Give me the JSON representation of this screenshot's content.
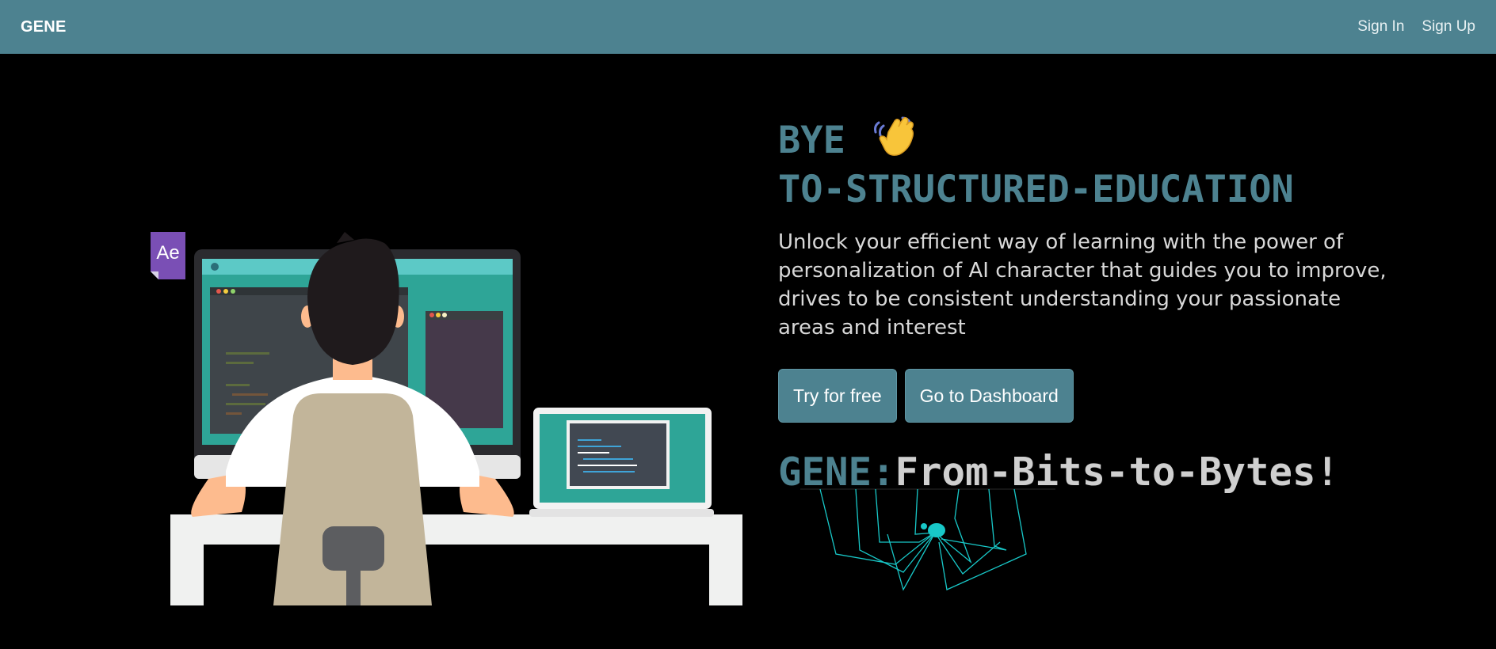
{
  "navbar": {
    "brand": "GENE",
    "links": [
      "Sign In",
      "Sign Up"
    ]
  },
  "hero": {
    "title_line1": "BYE",
    "title_line2": "TO-STRUCTURED-EDUCATION",
    "description": "Unlock your efficient way of learning with the power of personalization of AI character that guides you to improve, drives to be consistent understanding your passionate areas and interest",
    "buttons": [
      "Try for free",
      "Go to Dashboard"
    ],
    "tagline_prefix": "GENE:",
    "tagline_rest": "From-Bits-to-Bytes!"
  },
  "illustration": {
    "app_badge": "Ae"
  },
  "colors": {
    "primary": "#4d8290",
    "background": "#000000",
    "text_light": "#d8d8d8",
    "accent_cyan": "#18c8c8"
  },
  "icons": {
    "wave": "waving-hand-icon"
  }
}
